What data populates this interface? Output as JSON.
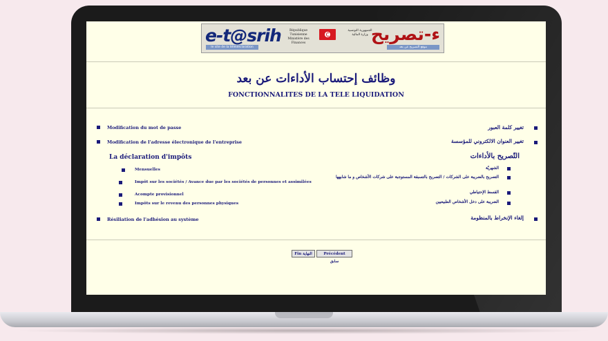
{
  "banner": {
    "logo_latin": "e-t@srih",
    "logo_arabic": "ء-تصريح",
    "fr_line1": "République Tunisienne",
    "fr_line2": "Ministère des Finances",
    "ar_line1": "الجمهورية التونسية",
    "ar_line2": "وزارة المالية",
    "tag_left": "le site de la télédéclaration",
    "tag_right": "موقع التصريح عن بعد"
  },
  "title": {
    "arabic": "وظائف إحتساب الأداءات عن بعد",
    "french": "FONCTIONNALITES DE LA TELE LIQUIDATION"
  },
  "menu": {
    "password_fr": "Modification du mot de passe",
    "password_ar": "تغيير كلمة العبور",
    "address_fr": "Modification de l'adresse électronique de l'entreprise",
    "address_ar": "تغيير العنوان الالكتروني للمؤسسة",
    "declaration_heading_fr": "La déclaration d'impôts",
    "declaration_heading_ar": "التّصريح بالأداءات",
    "sub_fr": [
      "Mensuelles",
      "Impôt sur les sociétés / Avance due par les sociétés de personnes et assimilées",
      "Acompte provisionnel",
      "Impôts sur le revenu des personnes physiques"
    ],
    "sub_ar": [
      "الشهريّة",
      "التصريح بالضريبة على الشركات / التصريح بالتسبقة المستوجبة على شركات الأشخاص و ما شابهها",
      "القسط الإحتياطي",
      "الضريبة على دخل الأشخاص الطبيعيين"
    ],
    "termination_fr": "Résiliation de l'adhésion au système",
    "termination_ar": "إلغاء الإنخراط بالمنظومة"
  },
  "buttons": {
    "end": "Fin النهاية",
    "previous": "Précédent سابق"
  },
  "colors": {
    "text": "#1a1a7a",
    "page_bg": "#ffffe8",
    "accent_red": "#b01215",
    "background": "#f7e9ed"
  }
}
